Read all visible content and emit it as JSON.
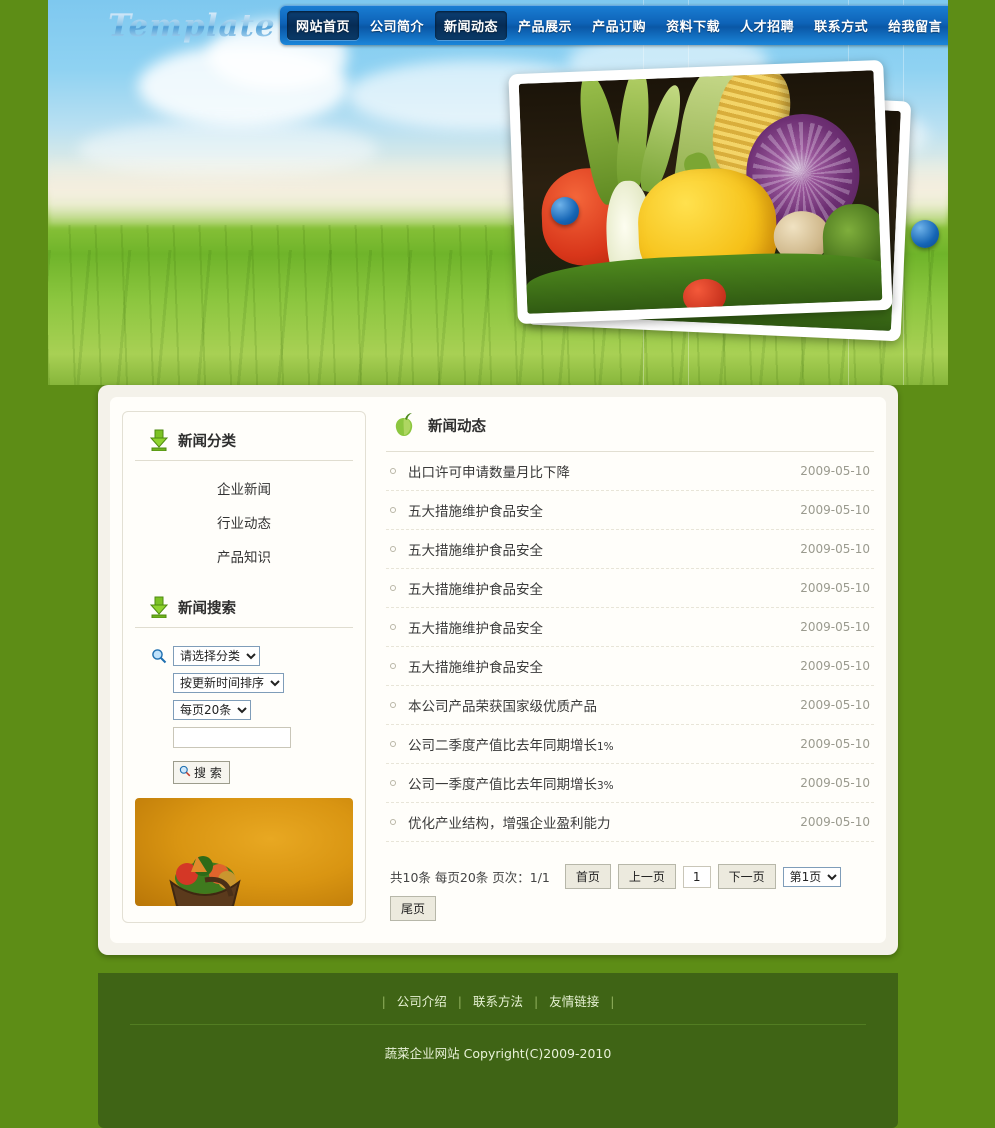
{
  "site": {
    "logo_text": "Template",
    "brand_blue": "#0e63b8",
    "brand_green": "#5d8d16",
    "footer_green": "#3f6415"
  },
  "nav": {
    "items": [
      {
        "label": "网站首页",
        "active": true
      },
      {
        "label": "公司简介",
        "active": false
      },
      {
        "label": "新闻动态",
        "active": true
      },
      {
        "label": "产品展示",
        "active": false
      },
      {
        "label": "产品订购",
        "active": false
      },
      {
        "label": "资料下载",
        "active": false
      },
      {
        "label": "人才招聘",
        "active": false
      },
      {
        "label": "联系方式",
        "active": false
      },
      {
        "label": "给我留言",
        "active": false
      }
    ]
  },
  "sidebar": {
    "category": {
      "title": "新闻分类",
      "icon": "green-down-arrow-icon",
      "items": [
        {
          "label": "企业新闻"
        },
        {
          "label": "行业动态"
        },
        {
          "label": "产品知识"
        }
      ]
    },
    "search": {
      "title": "新闻搜索",
      "icon": "green-down-arrow-icon",
      "magnifier_icon": "search-icon",
      "category_select": "请选择分类",
      "sort_select": "按更新时间排序",
      "pagesize_select": "每页20条",
      "keyword_value": "",
      "keyword_placeholder": "",
      "button_label": "搜 索"
    },
    "promo": {
      "alt": "vegetable-basket-banner"
    }
  },
  "news": {
    "title": "新闻动态",
    "icon": "green-pear-icon",
    "items": [
      {
        "title": "出口许可申请数量月比下降",
        "pct": "",
        "date": "2009-05-10"
      },
      {
        "title": "五大措施维护食品安全",
        "pct": "",
        "date": "2009-05-10"
      },
      {
        "title": "五大措施维护食品安全",
        "pct": "",
        "date": "2009-05-10"
      },
      {
        "title": "五大措施维护食品安全",
        "pct": "",
        "date": "2009-05-10"
      },
      {
        "title": "五大措施维护食品安全",
        "pct": "",
        "date": "2009-05-10"
      },
      {
        "title": "五大措施维护食品安全",
        "pct": "",
        "date": "2009-05-10"
      },
      {
        "title": "本公司产品荣获国家级优质产品",
        "pct": "",
        "date": "2009-05-10"
      },
      {
        "title": "公司二季度产值比去年同期增长",
        "pct": "1%",
        "date": "2009-05-10"
      },
      {
        "title": "公司一季度产值比去年同期增长",
        "pct": "3%",
        "date": "2009-05-10"
      },
      {
        "title": "优化产业结构，增强企业盈利能力",
        "pct": "",
        "date": "2009-05-10"
      }
    ]
  },
  "pager": {
    "info": "共10条 每页20条 页次：1/1",
    "first_label": "首页",
    "prev_label": "上一页",
    "current_page": "1",
    "next_label": "下一页",
    "jump_select": "第1页",
    "last_label": "尾页"
  },
  "footer": {
    "links": [
      {
        "label": "公司介绍"
      },
      {
        "label": "联系方法"
      },
      {
        "label": "友情链接"
      }
    ],
    "separator": "|",
    "copyright": "蔬菜企业网站  Copyright(C)2009-2010"
  }
}
